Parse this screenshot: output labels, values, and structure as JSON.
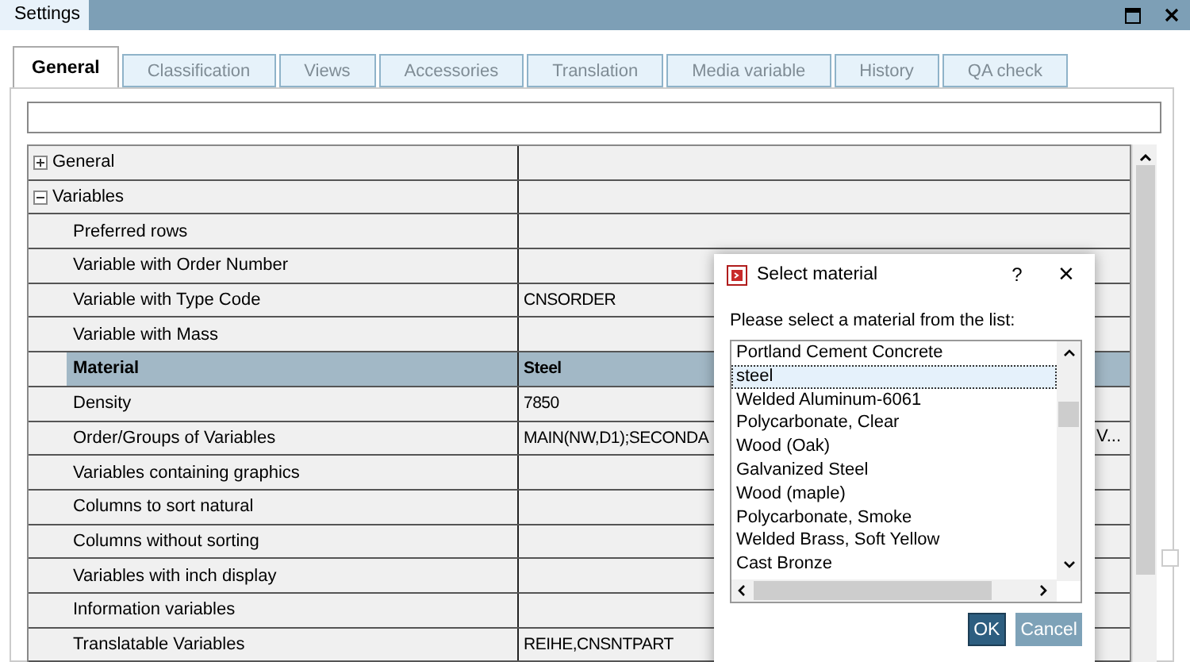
{
  "window": {
    "title": "Settings"
  },
  "tabs": [
    {
      "label": "General",
      "selected": true
    },
    {
      "label": "Classification",
      "selected": false
    },
    {
      "label": "Views",
      "selected": false
    },
    {
      "label": "Accessories",
      "selected": false
    },
    {
      "label": "Translation",
      "selected": false
    },
    {
      "label": "Media variable",
      "selected": false
    },
    {
      "label": "History",
      "selected": false
    },
    {
      "label": "QA check",
      "selected": false
    }
  ],
  "grid": {
    "groups": [
      {
        "label": "General",
        "expanded": false
      },
      {
        "label": "Variables",
        "expanded": true,
        "children": [
          {
            "label": "Preferred rows",
            "selected": false
          },
          {
            "label": "Variable with Order Number",
            "selected": false
          },
          {
            "label": "Variable with Type Code",
            "value": "CNSORDER",
            "selected": false
          },
          {
            "label": "Variable with Mass",
            "selected": false
          },
          {
            "label": "Material",
            "value": "Steel",
            "selected": true
          },
          {
            "label": "Density",
            "value": "7850",
            "selected": false
          },
          {
            "label": "Order/Groups of Variables",
            "value": "MAIN(NW,D1);SECONDA",
            "value_tail": "V...",
            "selected": false
          },
          {
            "label": "Variables containing graphics",
            "selected": false
          },
          {
            "label": "Columns to sort natural",
            "selected": false
          },
          {
            "label": "Columns without sorting",
            "selected": false
          },
          {
            "label": "Variables with inch display",
            "selected": false
          },
          {
            "label": "Information variables",
            "selected": false
          },
          {
            "label": "Translatable Variables",
            "value": "REIHE,CNSNTPART",
            "selected": false
          }
        ]
      }
    ]
  },
  "dialog": {
    "title": "Select material",
    "help": "?",
    "close": "×",
    "prompt": "Please select a material from the list:",
    "items": [
      {
        "label": "Portland Cement Concrete",
        "selected": false
      },
      {
        "label": "steel",
        "selected": true
      },
      {
        "label": "Welded Aluminum-6061",
        "selected": false
      },
      {
        "label": "Polycarbonate, Clear",
        "selected": false
      },
      {
        "label": "Wood (Oak)",
        "selected": false
      },
      {
        "label": "Galvanized Steel",
        "selected": false
      },
      {
        "label": "Wood (maple)",
        "selected": false
      },
      {
        "label": "Polycarbonate, Smoke",
        "selected": false
      },
      {
        "label": "Welded Brass, Soft Yellow",
        "selected": false
      },
      {
        "label": "Cast Bronze",
        "selected": false
      }
    ],
    "buttons": [
      {
        "label": "OK",
        "kind": "primary"
      },
      {
        "label": "Cancel",
        "kind": "secondary"
      }
    ]
  }
}
